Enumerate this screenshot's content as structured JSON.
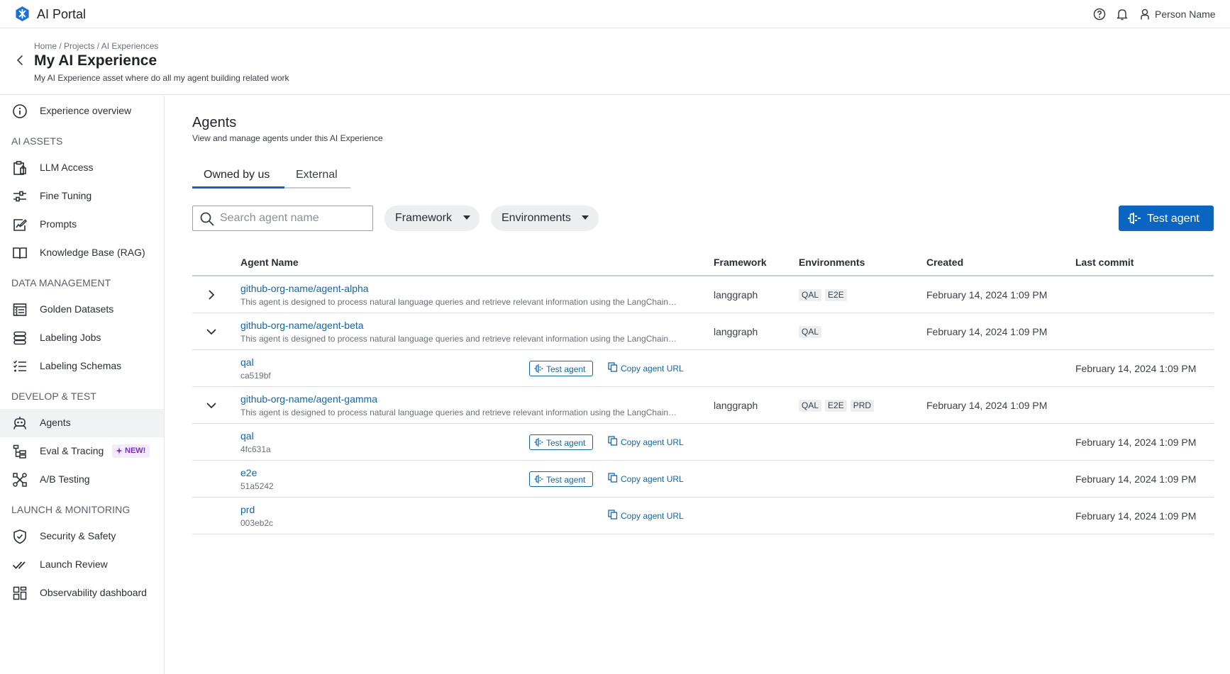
{
  "app": {
    "title": "AI Portal",
    "user_name": "Person Name"
  },
  "header": {
    "breadcrumb": "Home / Projects / AI Experiences",
    "title": "My AI Experience",
    "subtitle": "My AI Experience asset where do all my agent building related work"
  },
  "sidebar": {
    "overview": "Experience overview",
    "sections": {
      "ai_assets": "AI ASSETS",
      "data_management": "DATA MANAGEMENT",
      "develop_test": "DEVELOP & TEST",
      "launch_monitoring": "LAUNCH & MONITORING"
    },
    "items": {
      "llm_access": "LLM Access",
      "fine_tuning": "Fine Tuning",
      "prompts": "Prompts",
      "knowledge_base": "Knowledge Base (RAG)",
      "golden_datasets": "Golden Datasets",
      "labeling_jobs": "Labeling Jobs",
      "labeling_schemas": "Labeling Schemas",
      "agents": "Agents",
      "eval_tracing": "Eval & Tracing",
      "ab_testing": "A/B Testing",
      "security_safety": "Security & Safety",
      "launch_review": "Launch Review",
      "observability": "Observability dashboard"
    },
    "new_badge": "NEW!"
  },
  "main": {
    "title": "Agents",
    "subtitle": "View and manage agents under this AI Experience",
    "tabs": [
      "Owned by us",
      "External"
    ],
    "search_placeholder": "Search agent name",
    "filters": {
      "framework": "Framework",
      "environments": "Environments"
    },
    "primary_button": "Test agent",
    "columns": [
      "Agent Name",
      "Framework",
      "Environments",
      "Created",
      "Last commit"
    ],
    "agents": [
      {
        "name": "github-org-name/agent-alpha",
        "description": "This agent is designed to process natural language queries and retrieve relevant information using the LangChain…",
        "framework": "langgraph",
        "environments": [
          "QAL",
          "E2E"
        ],
        "created": "February 14, 2024 1:09 PM",
        "expanded": false
      },
      {
        "name": "github-org-name/agent-beta",
        "description": "This agent is designed to process natural language queries and retrieve relevant information using the LangChain…",
        "framework": "langgraph",
        "environments": [
          "QAL"
        ],
        "created": "February 14, 2024 1:09 PM",
        "expanded": true,
        "deployments": [
          {
            "env": "qal",
            "commit": "ca519bf",
            "last_commit": "February 14, 2024 1:09 PM",
            "test_label": "Test agent",
            "copy_label": "Copy agent URL"
          }
        ]
      },
      {
        "name": "github-org-name/agent-gamma",
        "description": "This agent is designed to process natural language queries and retrieve relevant information using the LangChain…",
        "framework": "langgraph",
        "environments": [
          "QAL",
          "E2E",
          "PRD"
        ],
        "created": "February 14, 2024 1:09 PM",
        "expanded": true,
        "deployments": [
          {
            "env": "qal",
            "commit": "4fc631a",
            "last_commit": "February 14, 2024 1:09 PM",
            "test_label": "Test agent",
            "copy_label": "Copy agent URL"
          },
          {
            "env": "e2e",
            "commit": "51a5242",
            "last_commit": "February 14, 2024 1:09 PM",
            "test_label": "Test agent",
            "copy_label": "Copy agent URL"
          },
          {
            "env": "prd",
            "commit": "003eb2c",
            "last_commit": "February 14, 2024 1:09 PM",
            "copy_label": "Copy agent URL"
          }
        ]
      }
    ]
  },
  "colors": {
    "accent": "#0a66c2",
    "new_badge_bg": "#f3eafc",
    "new_badge_text": "#7a2ad1"
  },
  "icons": [
    "logo-icon",
    "help-icon",
    "bell-icon",
    "user-icon",
    "back-icon",
    "info-icon",
    "search-icon",
    "plug-icon",
    "copy-icon",
    "chevron-right-icon",
    "chevron-down-icon"
  ]
}
